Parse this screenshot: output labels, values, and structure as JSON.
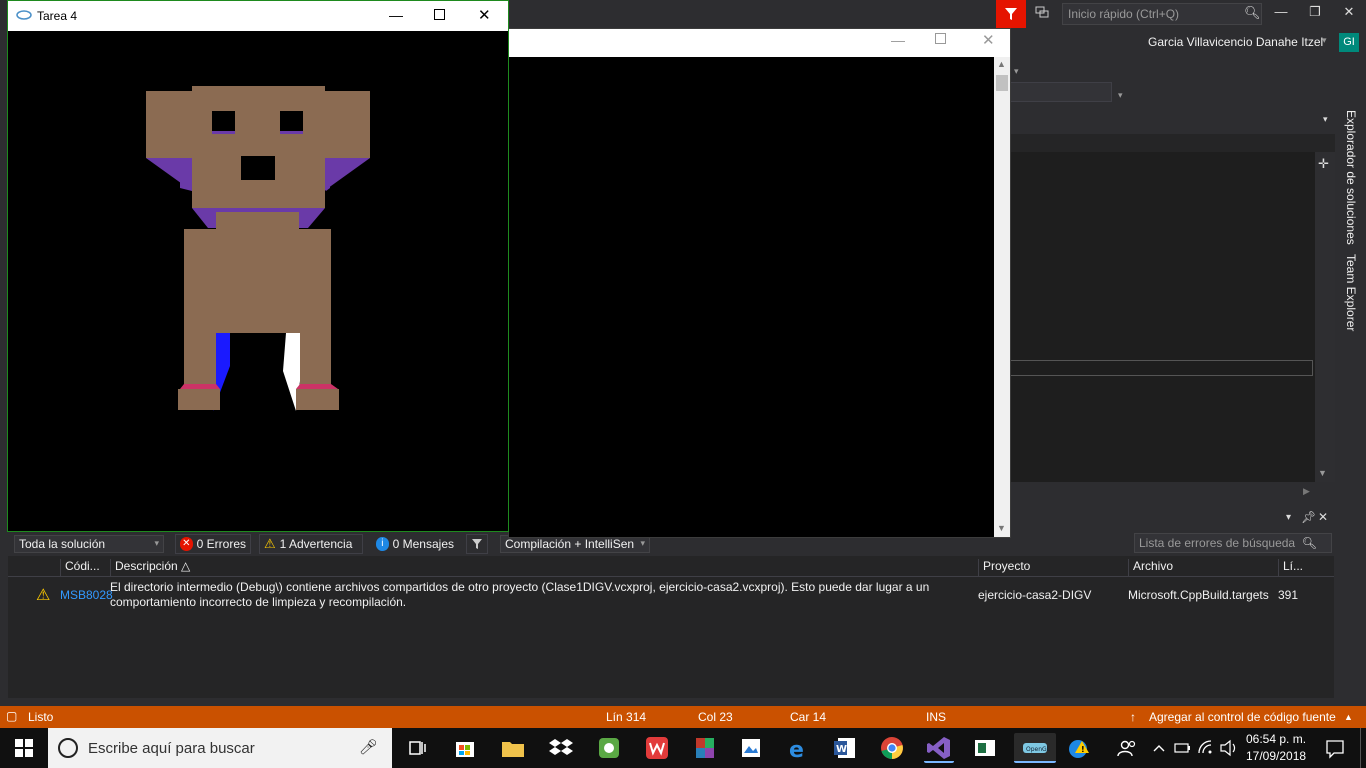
{
  "vs": {
    "quick_launch_placeholder": "Inicio rápido (Ctrl+Q)",
    "user_name": "Garcia Villavicencio Danahe Itzel",
    "user_initials": "GI",
    "side_tabs": [
      "Explorador de soluciones",
      "Team Explorer"
    ]
  },
  "tarea_window": {
    "title": "Tarea 4"
  },
  "error_list": {
    "scope": "Toda la solución",
    "errors": "0 Errores",
    "warnings": "1 Advertencia",
    "messages": "0 Mensajes",
    "build_filter": "Compilación + IntelliSen",
    "search_placeholder": "Lista de errores de búsqueda",
    "columns": [
      "Códi...",
      "Descripción",
      "Proyecto",
      "Archivo",
      "Lí..."
    ],
    "rows": [
      {
        "code": "MSB8028",
        "description_line1": "El directorio intermedio (Debug\\) contiene archivos compartidos de otro proyecto (Clase1DIGV.vcxproj, ejercicio-casa2.vcxproj). Esto puede dar lugar a un",
        "description_line2": "comportamiento incorrecto de limpieza y recompilación.",
        "project": "ejercicio-casa2-DIGV",
        "file": "Microsoft.CppBuild.targets",
        "line": "391"
      }
    ]
  },
  "status_bar": {
    "state": "Listo",
    "line": "Lín 314",
    "col": "Col 23",
    "car": "Car 14",
    "mode": "INS",
    "source_control": "Agregar al control de código fuente"
  },
  "taskbar": {
    "search_placeholder": "Escribe aquí para buscar",
    "time": "06:54 p. m.",
    "date": "17/09/2018"
  },
  "colors": {
    "vs_bg": "#2d2d30",
    "status_orange": "#ca5100",
    "dog_brown": "#8b6b52",
    "dog_purple": "#6a3aa8"
  }
}
